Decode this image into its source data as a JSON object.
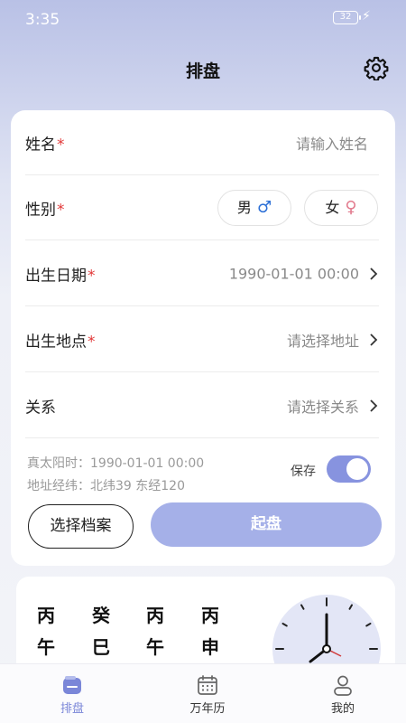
{
  "status_bar": {
    "time": "3:35",
    "battery": "32"
  },
  "header": {
    "title": "排盘"
  },
  "form": {
    "name": {
      "label": "姓名",
      "required": "*",
      "placeholder": "请输入姓名"
    },
    "gender": {
      "label": "性别",
      "required": "*",
      "male": "男",
      "male_symbol": "♂",
      "female": "女",
      "female_symbol": "♀"
    },
    "birth_date": {
      "label": "出生日期",
      "required": "*",
      "value": "1990-01-01 00:00"
    },
    "birth_place": {
      "label": "出生地点",
      "required": "*",
      "placeholder": "请选择地址"
    },
    "relation": {
      "label": "关系",
      "placeholder": "请选择关系"
    },
    "true_solar_time": "真太阳时：1990-01-01 00:00",
    "coordinates": "地址经纬：北纬39  东经120",
    "save": {
      "label": "保存",
      "enabled": true
    },
    "select_archive_button": "选择档案",
    "start_button": "起盘"
  },
  "bazi": {
    "stems": [
      "丙",
      "癸",
      "丙",
      "丙"
    ],
    "branches": [
      "午",
      "巳",
      "午",
      "申"
    ]
  },
  "tabs": [
    {
      "label": "排盘",
      "icon": "chart-icon",
      "active": true
    },
    {
      "label": "万年历",
      "icon": "calendar-icon",
      "active": false
    },
    {
      "label": "我的",
      "icon": "profile-icon",
      "active": false
    }
  ],
  "colors": {
    "accent": "#8793df",
    "start_button": "#a5b0e8",
    "required": "#e23b3b"
  }
}
